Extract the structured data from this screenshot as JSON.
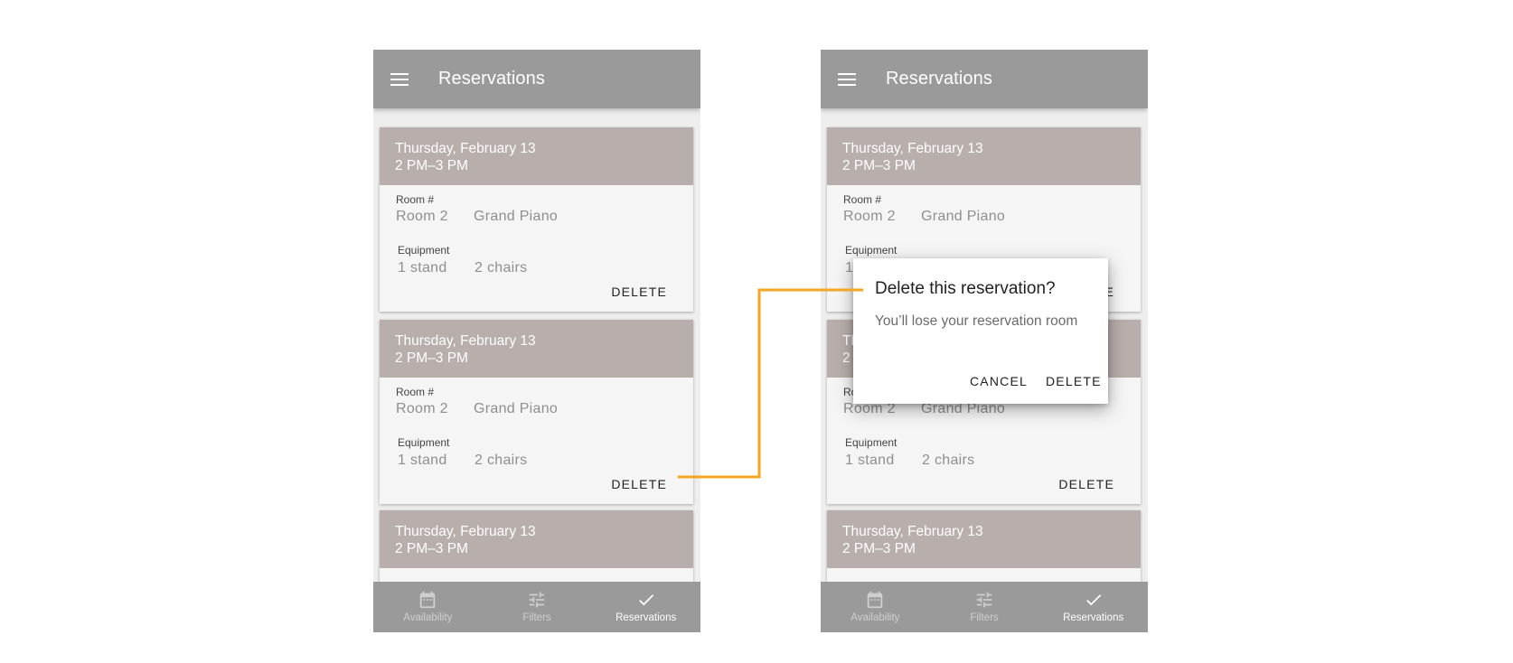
{
  "app": {
    "title": "Reservations",
    "menu_icon": "menu-icon"
  },
  "reservation": {
    "date": "Thursday, February 13",
    "time": "2 PM–3 PM",
    "room_label": "Room #",
    "room_value": "Room 2",
    "room_extra": "Grand Piano",
    "equipment_label": "Equipment",
    "equipment_item_1": "1 stand",
    "equipment_item_2": "2 chairs",
    "delete_label": "DELETE"
  },
  "nav": {
    "items": [
      {
        "label": "Availability",
        "icon": "calendar-icon"
      },
      {
        "label": "Filters",
        "icon": "sliders-icon"
      },
      {
        "label": "Reservations",
        "icon": "check-icon"
      }
    ],
    "active": "Reservations"
  },
  "dialog": {
    "title": "Delete this reservation?",
    "message": "You’ll lose your reservation room",
    "cancel_label": "CANCEL",
    "delete_label": "DELETE"
  },
  "colors": {
    "appbar": "#9a9a9a",
    "card_header": "#b8aeab",
    "connector": "#f5a623"
  }
}
